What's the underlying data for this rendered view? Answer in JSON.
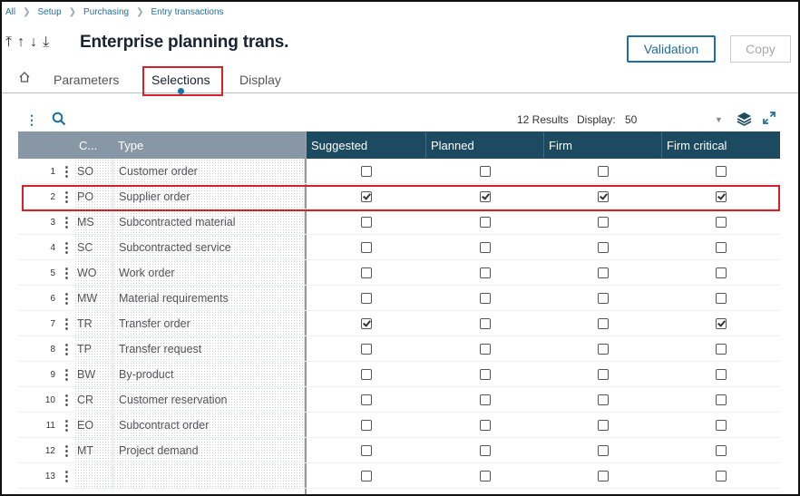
{
  "breadcrumb": [
    "All",
    "Setup",
    "Purchasing",
    "Entry transactions"
  ],
  "title": "Enterprise planning trans.",
  "buttons": {
    "validation": "Validation",
    "copy": "Copy"
  },
  "tabs": [
    "Parameters",
    "Selections",
    "Display"
  ],
  "toolbar": {
    "results": "12 Results",
    "display_label": "Display:",
    "display_value": "50"
  },
  "columns": {
    "code": "C...",
    "type": "Type",
    "suggested": "Suggested",
    "planned": "Planned",
    "firm": "Firm",
    "firm_critical": "Firm critical"
  },
  "rows": [
    {
      "n": "1",
      "code": "SO",
      "type": "Customer order",
      "s": false,
      "p": false,
      "f": false,
      "fc": false
    },
    {
      "n": "2",
      "code": "PO",
      "type": "Supplier order",
      "s": true,
      "p": true,
      "f": true,
      "fc": true
    },
    {
      "n": "3",
      "code": "MS",
      "type": "Subcontracted material",
      "s": false,
      "p": false,
      "f": false,
      "fc": false
    },
    {
      "n": "4",
      "code": "SC",
      "type": "Subcontracted service",
      "s": false,
      "p": false,
      "f": false,
      "fc": false
    },
    {
      "n": "5",
      "code": "WO",
      "type": "Work order",
      "s": false,
      "p": false,
      "f": false,
      "fc": false
    },
    {
      "n": "6",
      "code": "MW",
      "type": "Material requirements",
      "s": false,
      "p": false,
      "f": false,
      "fc": false
    },
    {
      "n": "7",
      "code": "TR",
      "type": "Transfer order",
      "s": true,
      "p": false,
      "f": false,
      "fc": true
    },
    {
      "n": "8",
      "code": "TP",
      "type": "Transfer request",
      "s": false,
      "p": false,
      "f": false,
      "fc": false
    },
    {
      "n": "9",
      "code": "BW",
      "type": "By-product",
      "s": false,
      "p": false,
      "f": false,
      "fc": false
    },
    {
      "n": "10",
      "code": "CR",
      "type": "Customer reservation",
      "s": false,
      "p": false,
      "f": false,
      "fc": false
    },
    {
      "n": "11",
      "code": "EO",
      "type": "Subcontract order",
      "s": false,
      "p": false,
      "f": false,
      "fc": false
    },
    {
      "n": "12",
      "code": "MT",
      "type": "Project demand",
      "s": false,
      "p": false,
      "f": false,
      "fc": false
    },
    {
      "n": "13",
      "code": "",
      "type": "",
      "s": false,
      "p": false,
      "f": false,
      "fc": false
    }
  ],
  "colors": {
    "header": "#1c4a60",
    "accent": "#1d6fa5",
    "highlight": "#d6202a"
  }
}
